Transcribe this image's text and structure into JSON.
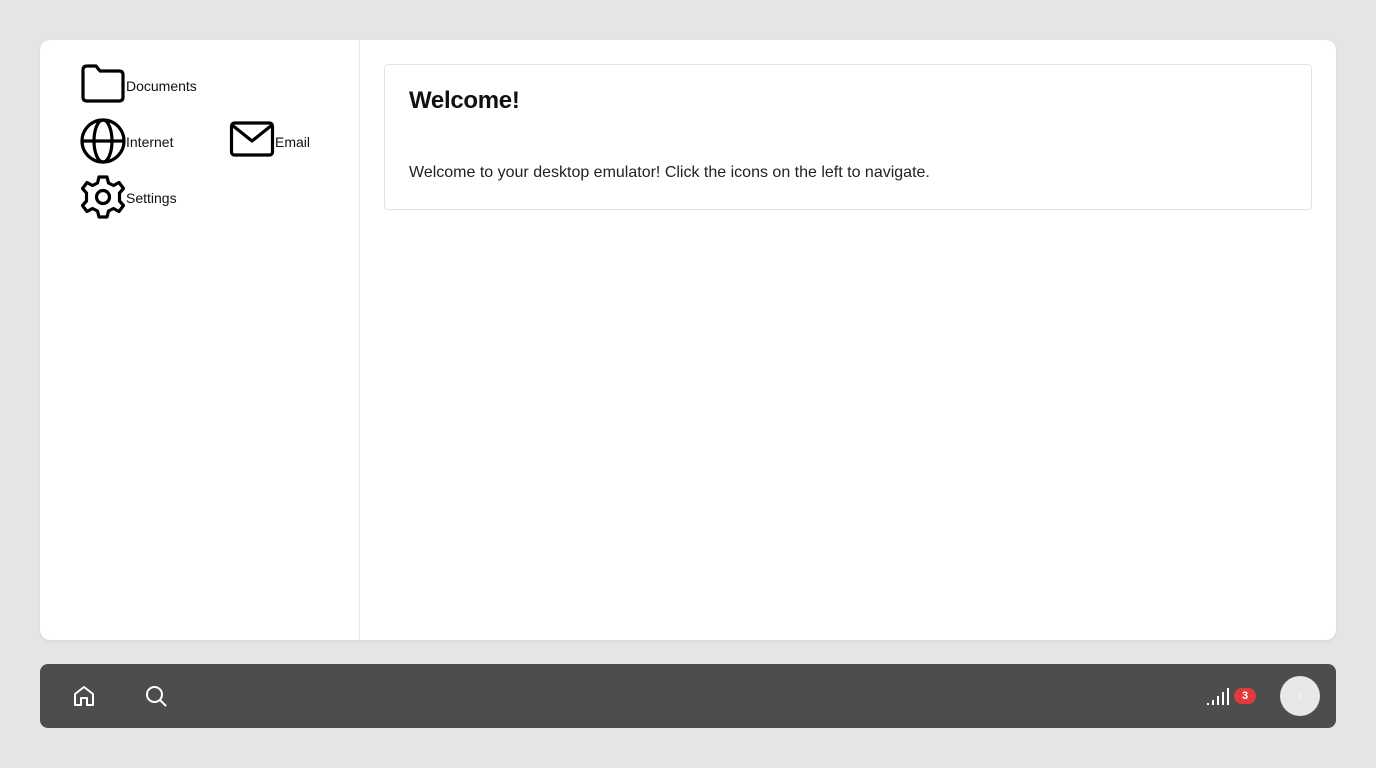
{
  "desktop": {
    "icons": [
      {
        "name": "folder-icon",
        "label": "Documents"
      },
      {
        "name": "globe-icon",
        "label": "Internet"
      },
      {
        "name": "mail-icon",
        "label": "Email"
      },
      {
        "name": "gear-icon",
        "label": "Settings"
      }
    ]
  },
  "welcome_card": {
    "title": "Welcome!",
    "message": "Welcome to your desktop emulator! Click the icons on the left to navigate."
  },
  "taskbar": {
    "left_icons": [
      "home-icon",
      "search-icon"
    ],
    "signal_icon": "signal-icon",
    "notification_count": "3",
    "badge_color": "#e23b3b",
    "background_color": "#4d4d4d"
  }
}
